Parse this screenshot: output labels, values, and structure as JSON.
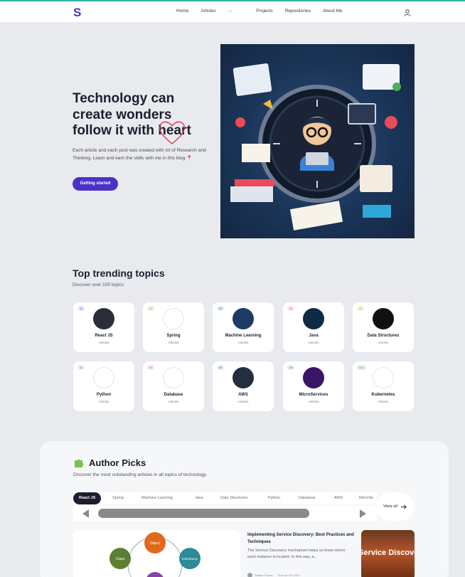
{
  "header": {
    "logo": "S",
    "nav": [
      {
        "label": "Home"
      },
      {
        "label": "Articles"
      },
      {
        "label": "Projects"
      },
      {
        "label": "Repositories"
      },
      {
        "label": "About Me"
      }
    ],
    "user_icon": "user-icon",
    "accent": "#4b31c8"
  },
  "hero": {
    "title_line1": "Technology can",
    "title_line2": "create wonders",
    "title_line3": "follow it with heart",
    "description": "Each article and each post was created with lot of Research and Thinking. Learn and earn the skills with me in this blog 📍",
    "cta": "Getting started"
  },
  "trending": {
    "title": "Top trending topics",
    "subtitle": "Discover over 100 topics",
    "topics": [
      {
        "num": "#1",
        "name": "React JS",
        "cap": "Articles",
        "icon": "react-icon",
        "color": "#7b3fe4",
        "bg": "#2b2d3a"
      },
      {
        "num": "#2",
        "name": "Spring",
        "cap": "Articles",
        "icon": "spring-icon",
        "color": "#6aad3d",
        "bg": "#ffffff"
      },
      {
        "num": "#3",
        "name": "Machine Learning",
        "cap": "Articles",
        "icon": "ml-icon",
        "color": "#2a6fb0",
        "bg": "#1d3b66"
      },
      {
        "num": "#4",
        "name": "Java",
        "cap": "Articles",
        "icon": "java-icon",
        "color": "#e04a8a",
        "bg": "#0f2a44"
      },
      {
        "num": "#5",
        "name": "Data Structures",
        "cap": "Articles",
        "icon": "data-structures-icon",
        "color": "#c8a400",
        "bg": "#111111"
      },
      {
        "num": "#6",
        "name": "Python",
        "cap": "Articles",
        "icon": "python-icon",
        "color": "#d049b0",
        "bg": "#ffffff"
      },
      {
        "num": "#7",
        "name": "Database",
        "cap": "Articles",
        "icon": "database-icon",
        "color": "#d04960",
        "bg": "#ffffff"
      },
      {
        "num": "#8",
        "name": "AWS",
        "cap": "Articles",
        "icon": "aws-icon",
        "color": "#2a6fb0",
        "bg": "#232f3e"
      },
      {
        "num": "#9",
        "name": "MicroServices",
        "cap": "Articles",
        "icon": "microservices-icon",
        "color": "#2d9c4a",
        "bg": "#3a1466"
      },
      {
        "num": "#10",
        "name": "Kubernetes",
        "cap": "Articles",
        "icon": "kubernetes-icon",
        "color": "#2d9c4a",
        "bg": "#ffffff"
      }
    ]
  },
  "picks": {
    "title": "Author Picks",
    "subtitle": "Discover the most outstanding articles in all topics of technology.",
    "tabs": [
      "React JS",
      "Spring",
      "Machine Learning",
      "Java",
      "Data Structures",
      "Python",
      "Database",
      "AWS",
      "MicroSe"
    ],
    "view_all": "View all",
    "diagram_nodes": [
      "Object",
      "Class",
      "Inheritance"
    ],
    "article": {
      "title": "Implementing Service Discovery: Best Practices and Techniques",
      "description": "The Service Discovery mechanism helps us know where each instance is located. In this way, a...",
      "author": "Shikea Thoms",
      "date": "Sun Jun 09 2024"
    },
    "thumb_label": "Service Discovery"
  }
}
